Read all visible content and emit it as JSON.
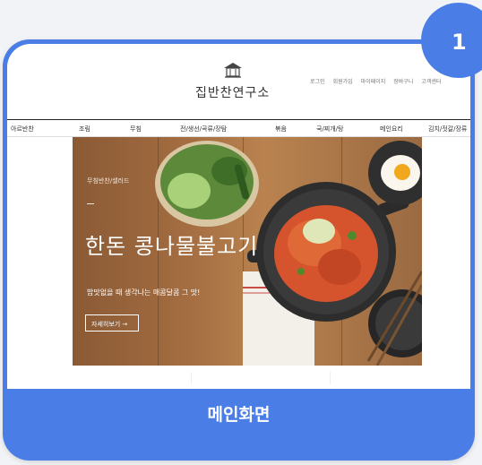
{
  "badge": {
    "number": "1"
  },
  "site": {
    "logo_text": "집반찬연구소"
  },
  "util_links": [
    "로그인",
    "회원가입",
    "마이페이지",
    "장바구니",
    "고객센터"
  ],
  "nav": [
    "아르반찬",
    "조림",
    "무침",
    "전/생선/곡류/장탐",
    "볶음",
    "국/찌개/탕",
    "메인요리",
    "김치/젓갈/장류"
  ],
  "hero": {
    "category": "무침반찬/샐러드",
    "title": "한돈 콩나물불고기",
    "subtitle": "밥맛없을 때 생각나는 매콤달콤 그 맛!",
    "button": "자세히보기 →"
  },
  "caption": "메인화면",
  "colors": {
    "accent": "#4a7de6",
    "background": "#f2f3f6"
  }
}
